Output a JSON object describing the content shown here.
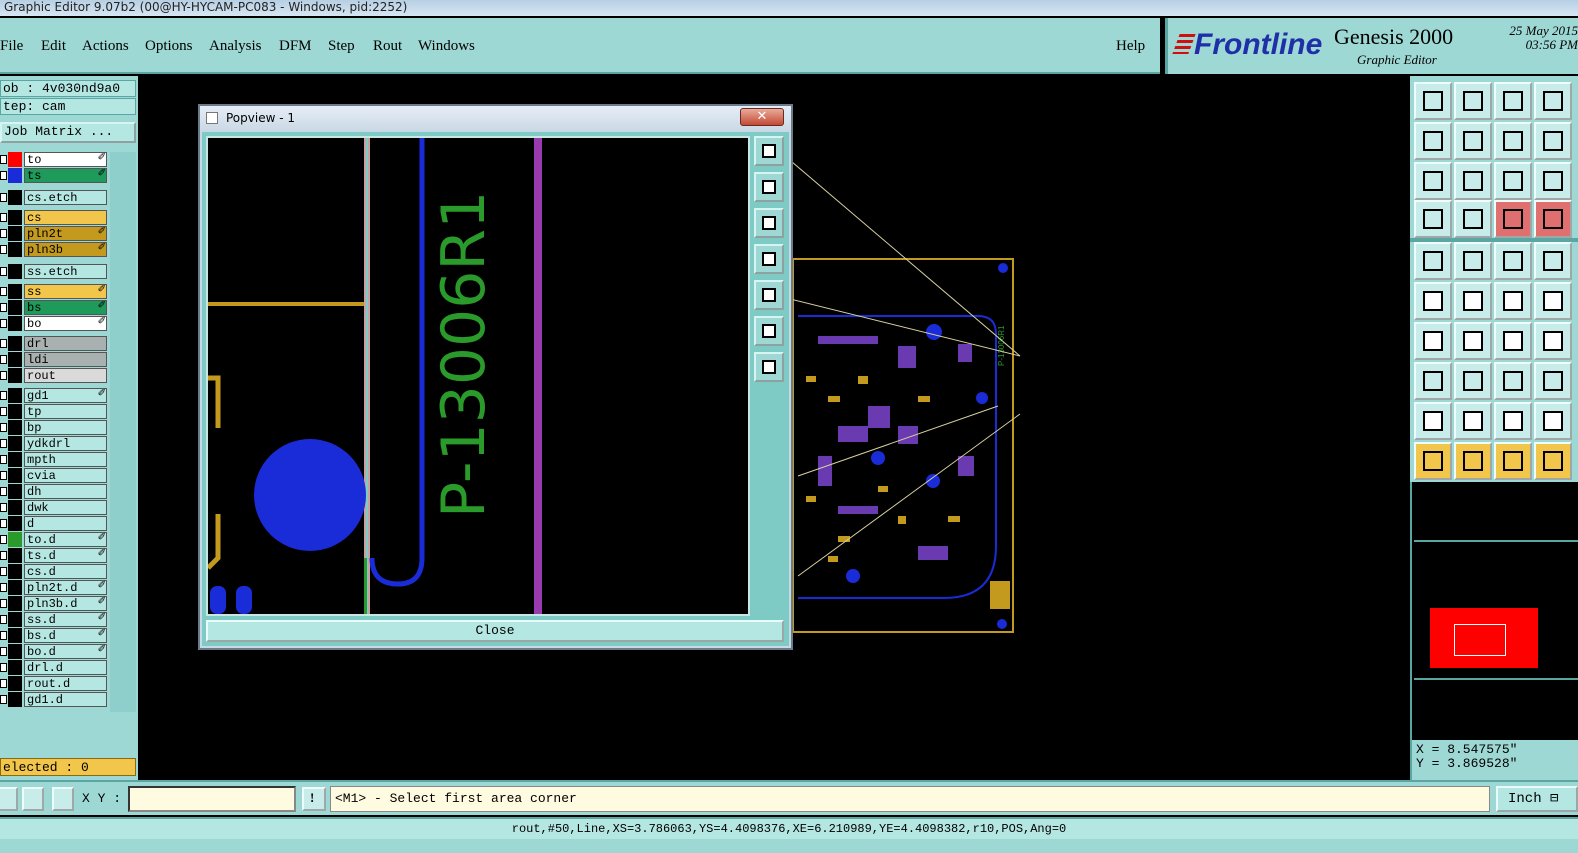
{
  "window": {
    "title": "Graphic Editor 9.07b2 (00@HY-HYCAM-PC083 - Windows, pid:2252)"
  },
  "menu": {
    "items": [
      "File",
      "Edit",
      "Actions",
      "Options",
      "Analysis",
      "DFM",
      "Step",
      "Rout",
      "Windows"
    ],
    "help": "Help"
  },
  "brand": {
    "logo": "Frontline",
    "product": "Genesis 2000",
    "subtitle": "Graphic Editor",
    "date": "25 May 2015",
    "time": "03:56 PM"
  },
  "left": {
    "job": "ob : 4v030nd9a0",
    "step": "tep: cam",
    "job_matrix": "Job Matrix ...",
    "selected": "elected : 0",
    "layers": [
      {
        "name": "to",
        "bg": "#ffffff",
        "swatch": "#ff0000",
        "flag": "✐"
      },
      {
        "name": "ts",
        "bg": "#1e9a5a",
        "swatch": "#1a2bd8",
        "flag": "✐"
      },
      {
        "name": "cs.etch",
        "bg": "#b4e6e2",
        "swatch": "#000000",
        "flag": ""
      },
      {
        "name": "cs",
        "bg": "#f2c64a",
        "swatch": "#000000",
        "flag": ""
      },
      {
        "name": "pln2t",
        "bg": "#c49a1e",
        "swatch": "#000000",
        "flag": "✐"
      },
      {
        "name": "pln3b",
        "bg": "#c49a1e",
        "swatch": "#000000",
        "flag": "✐"
      },
      {
        "name": "ss.etch",
        "bg": "#b4e6e2",
        "swatch": "#000000",
        "flag": ""
      },
      {
        "name": "ss",
        "bg": "#f2c64a",
        "swatch": "#000000",
        "flag": "✐"
      },
      {
        "name": "bs",
        "bg": "#1e9a5a",
        "swatch": "#000000",
        "flag": "✐"
      },
      {
        "name": "bo",
        "bg": "#ffffff",
        "swatch": "#000000",
        "flag": "✐"
      },
      {
        "name": "drl",
        "bg": "#a8b0b0",
        "swatch": "#000000",
        "flag": ""
      },
      {
        "name": "ldi",
        "bg": "#a8b0b0",
        "swatch": "#000000",
        "flag": ""
      },
      {
        "name": "rout",
        "bg": "#dadada",
        "swatch": "#000000",
        "flag": ""
      },
      {
        "name": "gd1",
        "bg": "#b4e6e2",
        "swatch": "#000000",
        "flag": "✐"
      },
      {
        "name": "tp",
        "bg": "#b4e6e2",
        "swatch": "#000000",
        "flag": ""
      },
      {
        "name": "bp",
        "bg": "#b4e6e2",
        "swatch": "#000000",
        "flag": ""
      },
      {
        "name": "ydkdrl",
        "bg": "#b4e6e2",
        "swatch": "#000000",
        "flag": ""
      },
      {
        "name": "mpth",
        "bg": "#b4e6e2",
        "swatch": "#000000",
        "flag": ""
      },
      {
        "name": "cvia",
        "bg": "#b4e6e2",
        "swatch": "#000000",
        "flag": ""
      },
      {
        "name": "dh",
        "bg": "#b4e6e2",
        "swatch": "#000000",
        "flag": ""
      },
      {
        "name": "dwk",
        "bg": "#b4e6e2",
        "swatch": "#000000",
        "flag": ""
      },
      {
        "name": "d",
        "bg": "#b4e6e2",
        "swatch": "#000000",
        "flag": ""
      },
      {
        "name": "to.d",
        "bg": "#b4e6e2",
        "swatch": "#2a9a2a",
        "flag": "✐"
      },
      {
        "name": "ts.d",
        "bg": "#b4e6e2",
        "swatch": "#000000",
        "flag": "✐"
      },
      {
        "name": "cs.d",
        "bg": "#b4e6e2",
        "swatch": "#000000",
        "flag": ""
      },
      {
        "name": "pln2t.d",
        "bg": "#b4e6e2",
        "swatch": "#000000",
        "flag": "✐"
      },
      {
        "name": "pln3b.d",
        "bg": "#b4e6e2",
        "swatch": "#000000",
        "flag": "✐"
      },
      {
        "name": "ss.d",
        "bg": "#b4e6e2",
        "swatch": "#000000",
        "flag": "✐"
      },
      {
        "name": "bs.d",
        "bg": "#b4e6e2",
        "swatch": "#000000",
        "flag": "✐"
      },
      {
        "name": "bo.d",
        "bg": "#b4e6e2",
        "swatch": "#000000",
        "flag": "✐"
      },
      {
        "name": "drl.d",
        "bg": "#b4e6e2",
        "swatch": "#000000",
        "flag": ""
      },
      {
        "name": "rout.d",
        "bg": "#b4e6e2",
        "swatch": "#000000",
        "flag": ""
      },
      {
        "name": "gd1.d",
        "bg": "#b4e6e2",
        "swatch": "#000000",
        "flag": ""
      }
    ]
  },
  "popview": {
    "title": "Popview - 1",
    "label_text": "P-13006R1",
    "close_label": "Close",
    "close_x": "✕"
  },
  "coords": {
    "x": "X = 8.547575\"",
    "y": "Y = 3.869528\""
  },
  "bottom": {
    "xy_label": "X Y :",
    "xy_value": "",
    "message": "<M1> - Select first area corner",
    "unit": "Inch",
    "unit_arrow": "⊟",
    "status": "rout,#50,Line,XS=3.786063,YS=4.4098376,XE=6.210989,YE=4.4098382,r10,POS,Ang=0"
  }
}
